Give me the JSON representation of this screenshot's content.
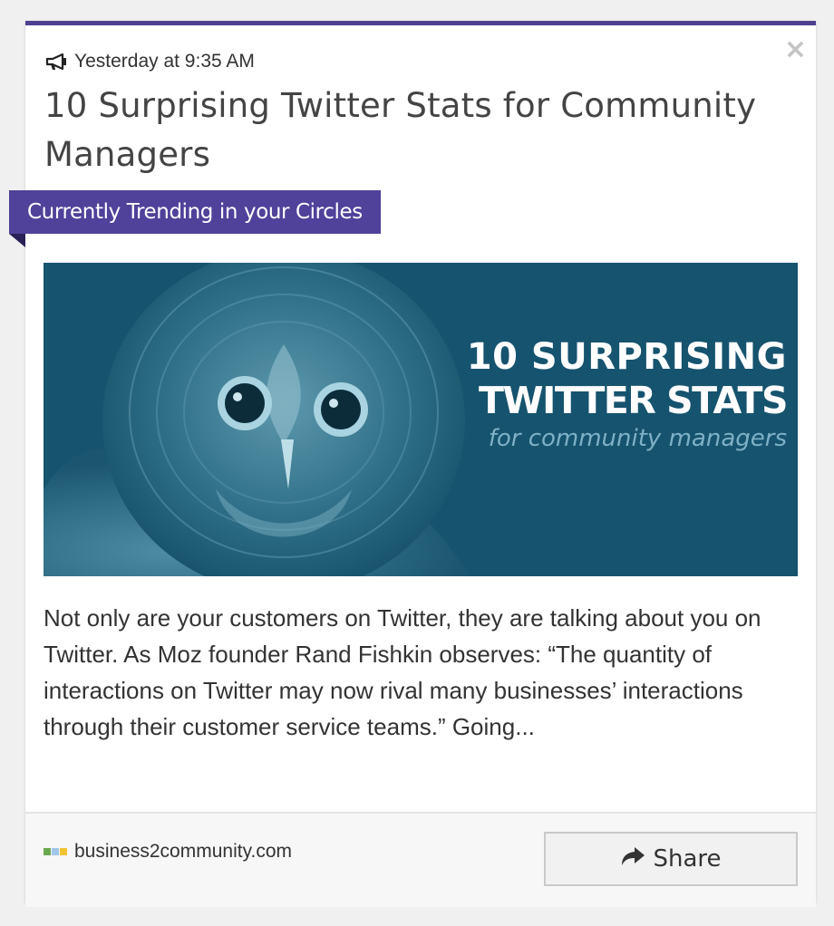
{
  "post": {
    "timestamp": "Yesterday at 9:35 AM",
    "title": "10 Surprising Twitter Stats for Community Managers",
    "trending_label": "Currently Trending in your Circles",
    "close_glyph": "×",
    "image": {
      "line1": "10 SURPRISING",
      "line2": "TWITTER STATS",
      "line3": "for community managers"
    },
    "excerpt": "Not only are your customers on Twitter, they are talking about you on Twitter. As Moz founder Rand Fishkin observes: “The quantity of interactions on Twitter may now rival many businesses’ interactions through their customer service teams.” Going...",
    "source": "business2community.com",
    "share_label": "Share"
  },
  "colors": {
    "accent": "#4f3f8f",
    "ribbon": "#50419a",
    "hero_bg": "#16536e"
  },
  "icons": {
    "timestamp": "megaphone-icon",
    "close": "close-icon",
    "share": "share-arrow-icon",
    "source": "favicon-icon"
  }
}
